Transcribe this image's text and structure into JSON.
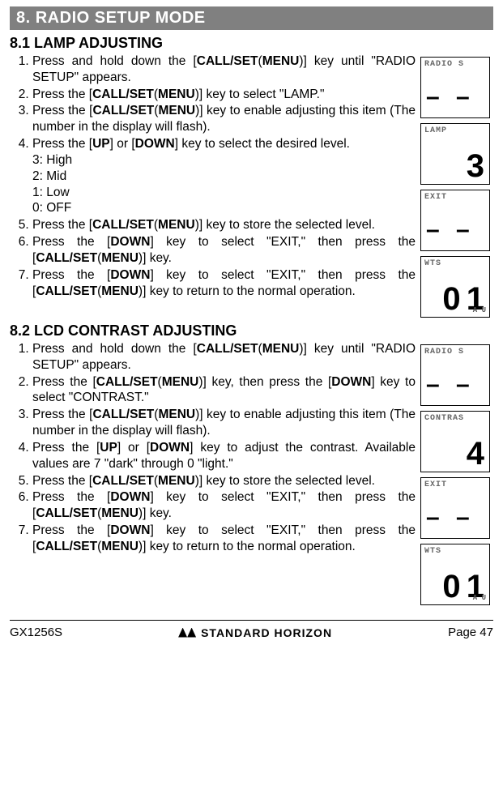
{
  "header": {
    "title": "8.  RADIO SETUP MODE"
  },
  "section1": {
    "title": "8.1  LAMP ADJUSTING",
    "steps": {
      "s1_a": "Press and hold down the [",
      "s1_key": "CALL/SET",
      "s1_par": "(",
      "s1_menu": "MENU",
      "s1_parc": ")",
      "s1_b": "] key until \"RADIO SETUP\" appears.",
      "s2_a": "Press the [",
      "s2_b": "] key to select \"LAMP.\"",
      "s3_a": "Press the [",
      "s3_b": "] key to enable adjusting this item (The number in the display will flash).",
      "s4_a": "Press the [",
      "s4_up": "UP",
      "s4_b": "] or [",
      "s4_down": "DOWN",
      "s4_c": "] key to select the desired level.",
      "levels": {
        "l3": "3: High",
        "l2": "2: Mid",
        "l1": "1: Low",
        "l0": "0: OFF"
      },
      "s5_a": "Press the [",
      "s5_b": "] key to store the selected level.",
      "s6_a": "Press the [",
      "s6_down": "DOWN",
      "s6_b": "] key to select \"EXIT,\" then press the [",
      "s6_c": "] key.",
      "s7_a": "Press the [",
      "s7_b": "] key to select \"EXIT,\" then press the [",
      "s7_c": "] key to return to the normal opera­tion."
    },
    "lcd": [
      {
        "top": "RADIO S",
        "main": "– –",
        "style": "dashes"
      },
      {
        "top": "LAMP",
        "main": "3"
      },
      {
        "top": "EXIT",
        "main": "– –",
        "style": "dashes"
      },
      {
        "top": "WTS",
        "main": "0 1",
        "sub": "A U"
      }
    ]
  },
  "section2": {
    "title": "8.2  LCD CONTRAST ADJUSTING",
    "steps": {
      "s1_a": "Press and hold down the [",
      "s1_b": "] key until \"RADIO SETUP\" appears.",
      "s2_a": "Press the [",
      "s2_b": "] key, then press the [",
      "s2_down": "DOWN",
      "s2_c": "] key to select \"CONTRAST.\"",
      "s3_a": "Press the [",
      "s3_b": "] key to enable adjusting this item (The number in the display will flash).",
      "s4_a": "Press the [",
      "s4_up": "UP",
      "s4_b": "] or [",
      "s4_down": "DOWN",
      "s4_c": "] key to adjust the contrast. Available values are 7 \"dark\" through 0 \"light.\"",
      "s5_a": "Press the [",
      "s5_b": "] key to store the selected level.",
      "s6_a": "Press the [",
      "s6_down": "DOWN",
      "s6_b": "] key to select \"EXIT,\" then press the [",
      "s6_c": "] key.",
      "s7_a": "Press the [",
      "s7_down": "DOWN",
      "s7_b": "] key to select \"EXIT,\" then press the [",
      "s7_c": "] key to return to the normal opera­tion."
    },
    "lcd": [
      {
        "top": "RADIO S",
        "main": "– –",
        "style": "dashes"
      },
      {
        "top": "CONTRAS",
        "main": "4"
      },
      {
        "top": "EXIT",
        "main": "– –",
        "style": "dashes"
      },
      {
        "top": "WTS",
        "main": "0 1",
        "sub": "A U"
      }
    ]
  },
  "keys": {
    "callset": "CALL/SET",
    "menu": "MENU",
    "paren_open": "(",
    "paren_close": ")"
  },
  "footer": {
    "left": "GX1256S",
    "center": "STANDARD HORIZON",
    "right": "Page 47"
  }
}
